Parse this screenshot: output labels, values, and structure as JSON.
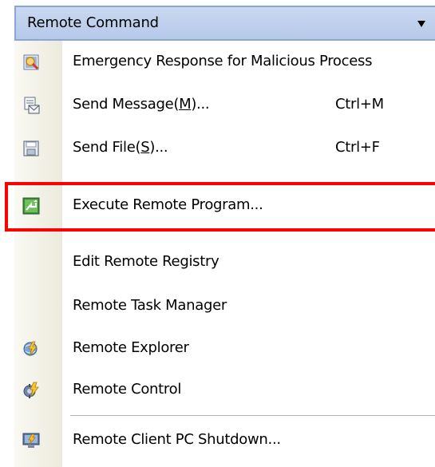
{
  "header": {
    "title": "Remote Command"
  },
  "menu": {
    "items": [
      {
        "label": "Emergency Response for Malicious Process",
        "shortcut": "",
        "icon": "shield-process-icon"
      },
      {
        "label": "Send Message(M)...",
        "label_pre": "Send Message(",
        "label_accel": "M",
        "label_post": ")...",
        "shortcut": "Ctrl+M",
        "icon": "message-icon"
      },
      {
        "label": "Send File(S)...",
        "label_pre": "Send File(",
        "label_accel": "S",
        "label_post": ")...",
        "shortcut": "Ctrl+F",
        "icon": "file-icon"
      },
      {
        "label": "Execute Remote Program...",
        "shortcut": "",
        "icon": "execute-program-icon"
      },
      {
        "label": "Edit Remote Registry",
        "shortcut": "",
        "icon": ""
      },
      {
        "label": "Remote Task Manager",
        "shortcut": "",
        "icon": ""
      },
      {
        "label": "Remote Explorer",
        "shortcut": "",
        "icon": "remote-explorer-icon"
      },
      {
        "label": "Remote Control",
        "shortcut": "",
        "icon": "remote-control-icon"
      },
      {
        "label": "Remote Client PC Shutdown...",
        "shortcut": "",
        "icon": "shutdown-icon"
      }
    ]
  },
  "colors": {
    "highlight_border": "#ff0000",
    "header_bg": "#c9d8f0"
  }
}
